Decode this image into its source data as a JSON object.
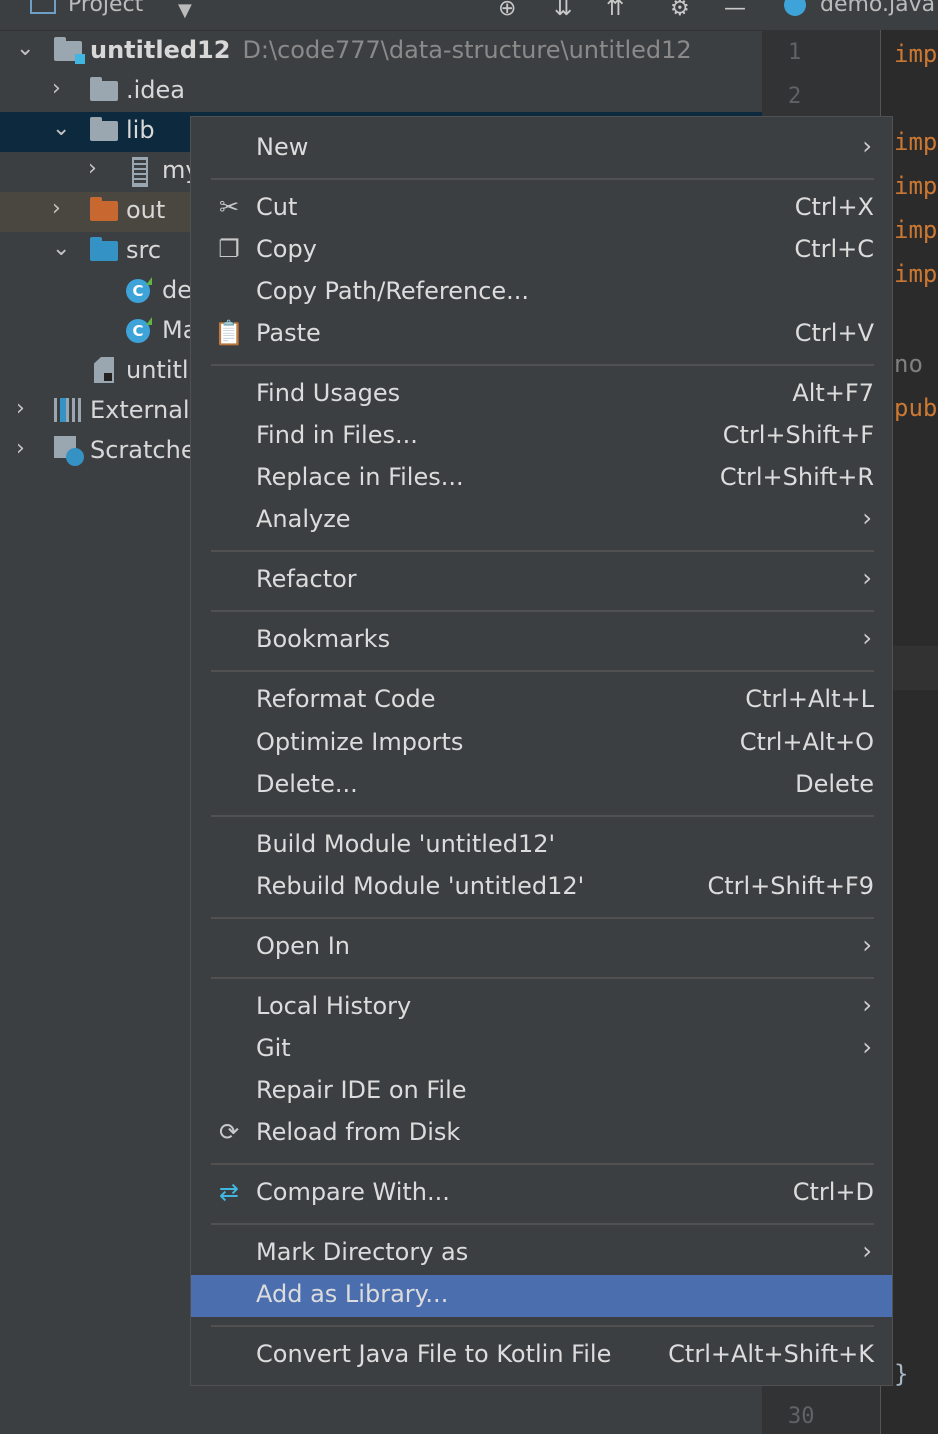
{
  "window": {
    "project_title": "Project",
    "editor_tab": "demo.java"
  },
  "tree": {
    "root": {
      "name": "untitled12",
      "path": "D:\\code777\\data-structure\\untitled12"
    },
    "idea": ".idea",
    "lib": "lib",
    "lib_child": "my",
    "out": "out",
    "src": "src",
    "src_child1": "de",
    "src_child2": "Ma",
    "iml": "untitle",
    "external": "External",
    "scratches": "Scratche"
  },
  "editor": {
    "line_numbers": [
      "1",
      "2",
      "30"
    ],
    "code_lines": [
      "imp",
      "imp",
      "imp",
      "imp",
      "imp",
      "no u",
      "pub",
      "}"
    ]
  },
  "menu": {
    "new": "New",
    "cut": "Cut",
    "cut_sc": "Ctrl+X",
    "copy": "Copy",
    "copy_sc": "Ctrl+C",
    "copy_path": "Copy Path/Reference...",
    "paste": "Paste",
    "paste_sc": "Ctrl+V",
    "find_usages": "Find Usages",
    "find_usages_sc": "Alt+F7",
    "find_in_files": "Find in Files...",
    "find_in_files_sc": "Ctrl+Shift+F",
    "replace_in_files": "Replace in Files...",
    "replace_in_files_sc": "Ctrl+Shift+R",
    "analyze": "Analyze",
    "refactor": "Refactor",
    "bookmarks": "Bookmarks",
    "reformat": "Reformat Code",
    "reformat_sc": "Ctrl+Alt+L",
    "optimize": "Optimize Imports",
    "optimize_sc": "Ctrl+Alt+O",
    "delete": "Delete...",
    "delete_sc": "Delete",
    "build_module": "Build Module 'untitled12'",
    "rebuild_module": "Rebuild Module 'untitled12'",
    "rebuild_module_sc": "Ctrl+Shift+F9",
    "open_in": "Open In",
    "local_history": "Local History",
    "git": "Git",
    "repair_ide": "Repair IDE on File",
    "reload": "Reload from Disk",
    "compare": "Compare With...",
    "compare_sc": "Ctrl+D",
    "mark_dir": "Mark Directory as",
    "add_library": "Add as Library...",
    "convert": "Convert Java File to Kotlin File",
    "convert_sc": "Ctrl+Alt+Shift+K"
  },
  "colors": {
    "menu_bg": "#3c3f41",
    "highlight": "#4b6eaf",
    "selection": "#0d293e",
    "keyword": "#cc7832"
  }
}
